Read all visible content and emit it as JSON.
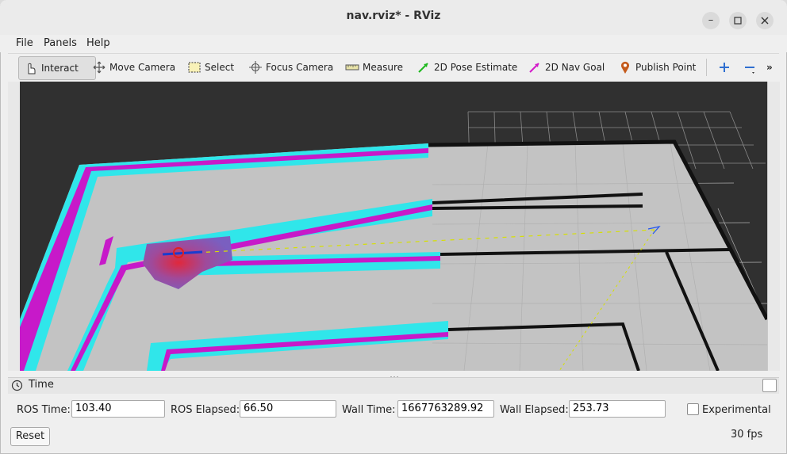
{
  "window": {
    "title": "nav.rviz* - RViz",
    "minimize_icon": "minimize-icon",
    "maximize_icon": "maximize-icon",
    "close_icon": "close-icon"
  },
  "menu": [
    "File",
    "Panels",
    "Help"
  ],
  "toolbar": {
    "interact": "Interact",
    "move_camera": "Move Camera",
    "select": "Select",
    "focus_camera": "Focus Camera",
    "measure": "Measure",
    "pose_estimate": "2D Pose Estimate",
    "nav_goal": "2D Nav Goal",
    "publish_point": "Publish Point",
    "pose_color": "#1db81d",
    "goal_color": "#d319c9",
    "point_color": "#c45a1b"
  },
  "viewport": {
    "background": "#303030",
    "floor_color": "#c4c4c4",
    "wall_color": "#111111",
    "inflation_cyan": "#30e6ea",
    "inflation_magenta": "#c719c9"
  },
  "time_panel": {
    "title": "Time",
    "ros_time_label": "ROS Time:",
    "ros_time": "103.40",
    "ros_elapsed_label": "ROS Elapsed:",
    "ros_elapsed": "66.50",
    "wall_time_label": "Wall Time:",
    "wall_time": "1667763289.92",
    "wall_elapsed_label": "Wall Elapsed:",
    "wall_elapsed": "253.73",
    "experimental_label": "Experimental",
    "reset_label": "Reset",
    "fps": "30 fps"
  }
}
